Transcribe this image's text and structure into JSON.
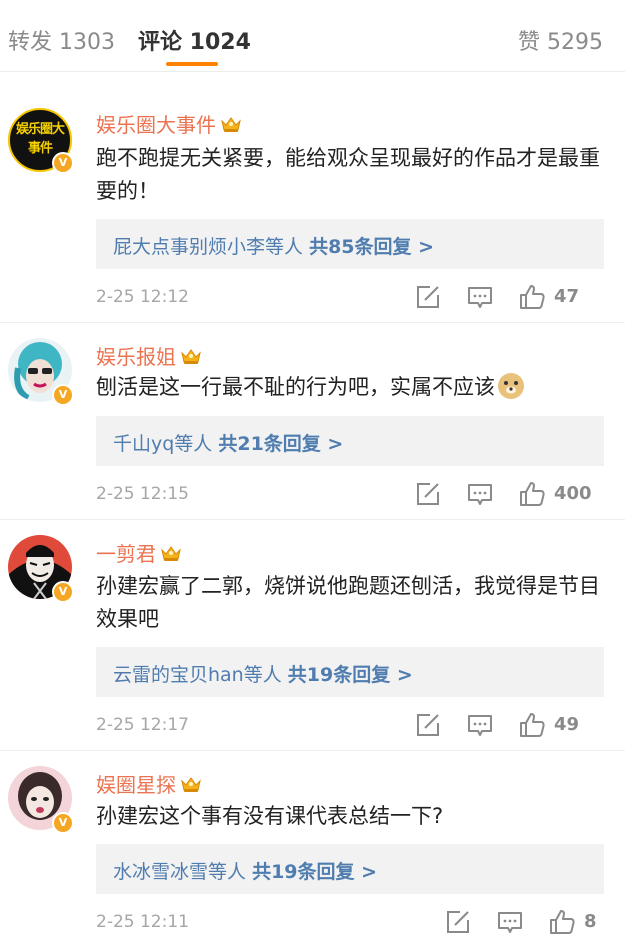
{
  "tabs": {
    "repost": "转发 1303",
    "comments": "评论 1024",
    "likes": "赞 5295"
  },
  "colors": {
    "accent": "#ff8200",
    "username": "#eb7350",
    "link": "#507daf",
    "meta": "#a6a6a6",
    "reply_bg": "#f2f2f2"
  },
  "comments": [
    {
      "username": "娱乐圈大事件",
      "avatar_text": "娱乐圈大事件",
      "text": "跑不跑提无关紧要，能给观众呈现最好的作品才是最重要的！",
      "reply_users": "屁大点事别烦小李等人",
      "reply_count": "共85条回复 >",
      "time": "2-25 12:12",
      "likes": "47"
    },
    {
      "username": "娱乐报姐",
      "text": "刨活是这一行最不耻的行为吧，实属不应该",
      "emoji": "doge",
      "reply_users": "千山yq等人",
      "reply_count": "共21条回复 >",
      "time": "2-25 12:15",
      "likes": "400"
    },
    {
      "username": "一剪君",
      "text": "孙建宏赢了二郭，烧饼说他跑题还刨活，我觉得是节目效果吧",
      "reply_users": "云雷的宝贝han等人",
      "reply_count": "共19条回复 >",
      "time": "2-25 12:17",
      "likes": "49"
    },
    {
      "username": "娱圈星探",
      "text": "孙建宏这个事有没有课代表总结一下?",
      "reply_users": "水冰雪冰雪等人",
      "reply_count": "共19条回复 >",
      "time": "2-25 12:11",
      "likes": "8"
    }
  ]
}
